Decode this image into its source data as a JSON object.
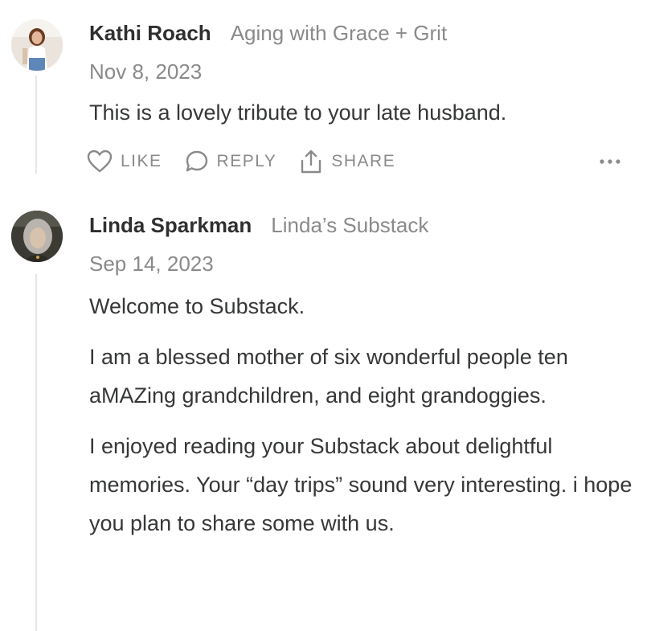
{
  "comments": [
    {
      "author": "Kathi Roach",
      "publication": "Aging with Grace + Grit",
      "date": "Nov 8, 2023",
      "paragraphs": [
        "This is a lovely tribute to your late husband."
      ],
      "actions": {
        "like": "LIKE",
        "reply": "REPLY",
        "share": "SHARE"
      },
      "more_icon": "ellipsis-icon"
    },
    {
      "author": "Linda Sparkman",
      "publication": "Linda’s Substack",
      "date": "Sep 14, 2023",
      "paragraphs": [
        "Welcome to Substack.",
        "I am a blessed mother of six wonderful people ten aMAZing grandchildren, and eight grandoggies.",
        "I enjoyed reading your Substack about delightful memories. Your “day trips” sound very interesting. i hope you plan to share some with us."
      ]
    }
  ],
  "colors": {
    "text": "#363737",
    "muted": "#8a8a8a",
    "thread_line": "#e6e6e6"
  }
}
